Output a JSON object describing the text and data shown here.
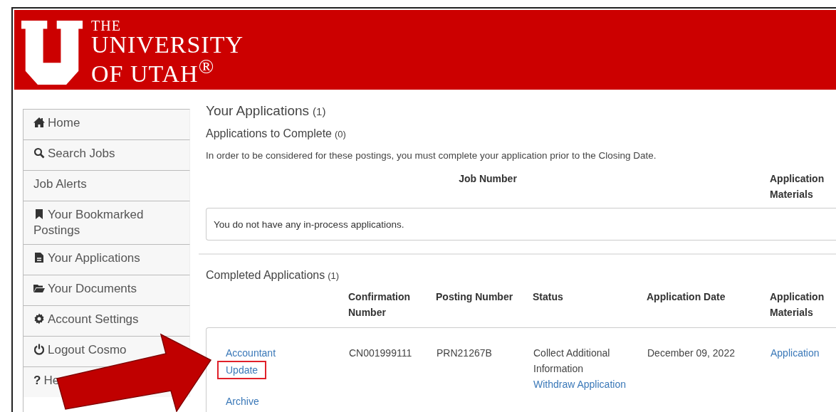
{
  "header": {
    "logo_lines": [
      "THE",
      "UNIVERSITY",
      "OF UTAH$^{®}$"
    ]
  },
  "sidebar": {
    "items": [
      {
        "kind": "home",
        "label": "Home"
      },
      {
        "kind": "search",
        "label": "Search Jobs"
      },
      {
        "kind": "plain",
        "label": "Job Alerts"
      },
      {
        "kind": "bookmark",
        "label": "Your Bookmarked Postings"
      },
      {
        "kind": "file",
        "label": "Your Applications"
      },
      {
        "kind": "folder",
        "label": "Your Documents"
      },
      {
        "kind": "gear",
        "label": "Account Settings"
      },
      {
        "kind": "power",
        "label": "Logout Cosmo"
      },
      {
        "kind": "glyph",
        "glyph": "?",
        "label": "He"
      }
    ]
  },
  "main": {
    "title": "Your Applications",
    "title_count": "(1)",
    "to_complete": {
      "heading": "Applications to Complete",
      "count": "(0)",
      "note": "In order to be considered for these postings, you must complete your application prior to the Closing Date.",
      "columns": [
        "Job Number",
        "Application Materials"
      ],
      "empty": "You do not have any in-process applications."
    },
    "completed": {
      "heading": "Completed Applications",
      "count": "(1)",
      "columns": [
        "Confirmation Number",
        "Posting Number",
        "Status",
        "Application Date",
        "Application Materials"
      ],
      "rows": [
        {
          "job": "Accountant",
          "actions": [
            {
              "label": "Update",
              "highlighted": true
            },
            {
              "label": "Archive",
              "highlighted": false
            }
          ],
          "confirmation": "CN001999111",
          "posting": "PRN21267B",
          "status": "Collect Additional Information",
          "status_action": "Withdraw Application",
          "date": "December 09, 2022",
          "materials": "Application"
        }
      ]
    }
  },
  "annotation": {
    "kind": "arrow"
  }
}
